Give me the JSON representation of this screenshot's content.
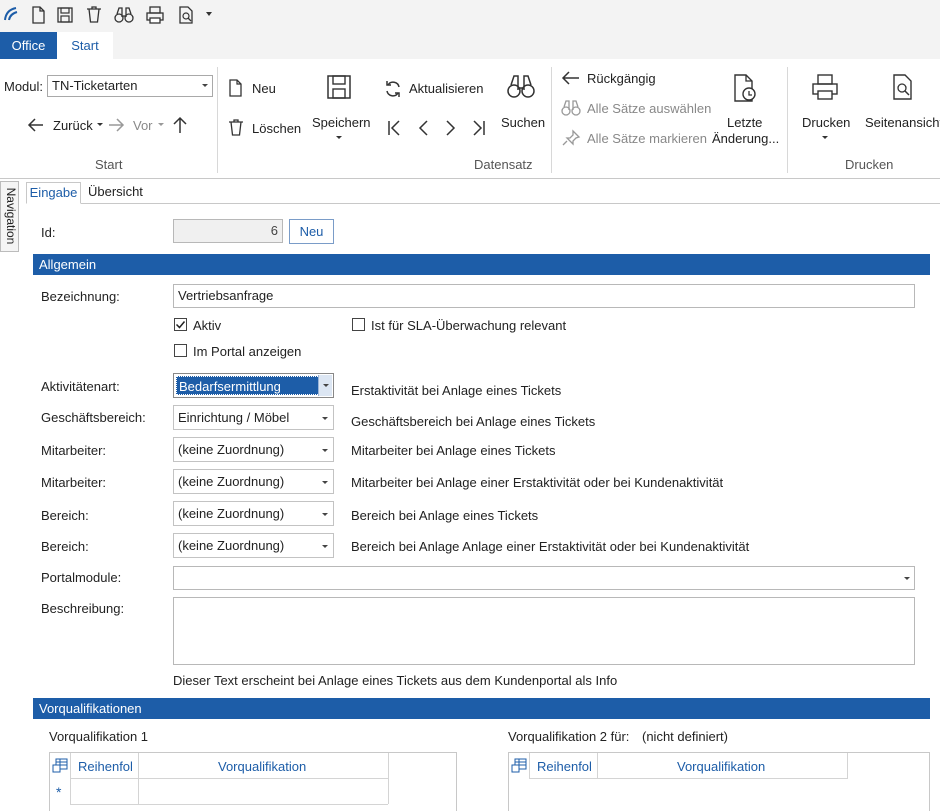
{
  "tabs": {
    "office": "Office",
    "start": "Start"
  },
  "ribbon": {
    "modul_label": "Modul:",
    "modul_value": "TN-Ticketarten",
    "zurueck": "Zurück",
    "vor": "Vor",
    "group_start": "Start",
    "neu": "Neu",
    "loeschen": "Löschen",
    "speichern": "Speichern",
    "aktualisieren": "Aktualisieren",
    "suchen": "Suchen",
    "rueckgaengig": "Rückgängig",
    "alle_auswaehlen": "Alle Sätze auswählen",
    "alle_markieren": "Alle Sätze markieren",
    "letzte": "Letzte",
    "aenderung": "Änderung...",
    "group_datensatz": "Datensatz",
    "drucken": "Drucken",
    "seitenansicht": "Seitenansicht",
    "group_drucken": "Drucken"
  },
  "nav": {
    "label": "Navigation"
  },
  "form_tabs": {
    "eingabe": "Eingabe",
    "uebersicht": "Übersicht"
  },
  "form": {
    "id_label": "Id:",
    "id_value": "6",
    "neu_button": "Neu",
    "section_allgemein": "Allgemein",
    "bezeichnung_label": "Bezeichnung:",
    "bezeichnung_value": "Vertriebsanfrage",
    "aktiv": "Aktiv",
    "sla": "Ist für SLA-Überwachung relevant",
    "portal": "Im Portal anzeigen",
    "rows": [
      {
        "label": "Aktivitätenart:",
        "value": "Bedarfsermittlung",
        "note": "Erstaktivität bei Anlage eines Tickets"
      },
      {
        "label": "Geschäftsbereich:",
        "value": "Einrichtung / Möbel",
        "note": "Geschäftsbereich bei Anlage eines Tickets"
      },
      {
        "label": "Mitarbeiter:",
        "value": "(keine Zuordnung)",
        "note": "Mitarbeiter bei Anlage eines Tickets"
      },
      {
        "label": "Mitarbeiter:",
        "value": "(keine Zuordnung)",
        "note": "Mitarbeiter bei Anlage einer Erstaktivität oder bei Kundenaktivität"
      },
      {
        "label": "Bereich:",
        "value": "(keine Zuordnung)",
        "note": "Bereich bei Anlage eines Tickets"
      },
      {
        "label": "Bereich:",
        "value": "(keine Zuordnung)",
        "note": "Bereich bei Anlage Anlage einer Erstaktivität oder bei Kundenaktivität"
      }
    ],
    "portalmodule_label": "Portalmodule:",
    "portalmodule_value": "",
    "beschreibung_label": "Beschreibung:",
    "beschreibung_value": "",
    "beschreibung_hint": "Dieser Text erscheint bei Anlage eines Tickets aus dem Kundenportal als Info",
    "section_vorqual": "Vorqualifikationen",
    "vq1_title": "Vorqualifikation 1",
    "vq2_title": "Vorqualifikation 2 für:",
    "vq2_value": "(nicht definiert)",
    "col_reihenfolge": "Reihenfol",
    "col_vorqual": "Vorqualifikation",
    "new_row_marker": "*"
  },
  "colors": {
    "accent": "#1d5da8",
    "selection": "#1d5da8"
  }
}
